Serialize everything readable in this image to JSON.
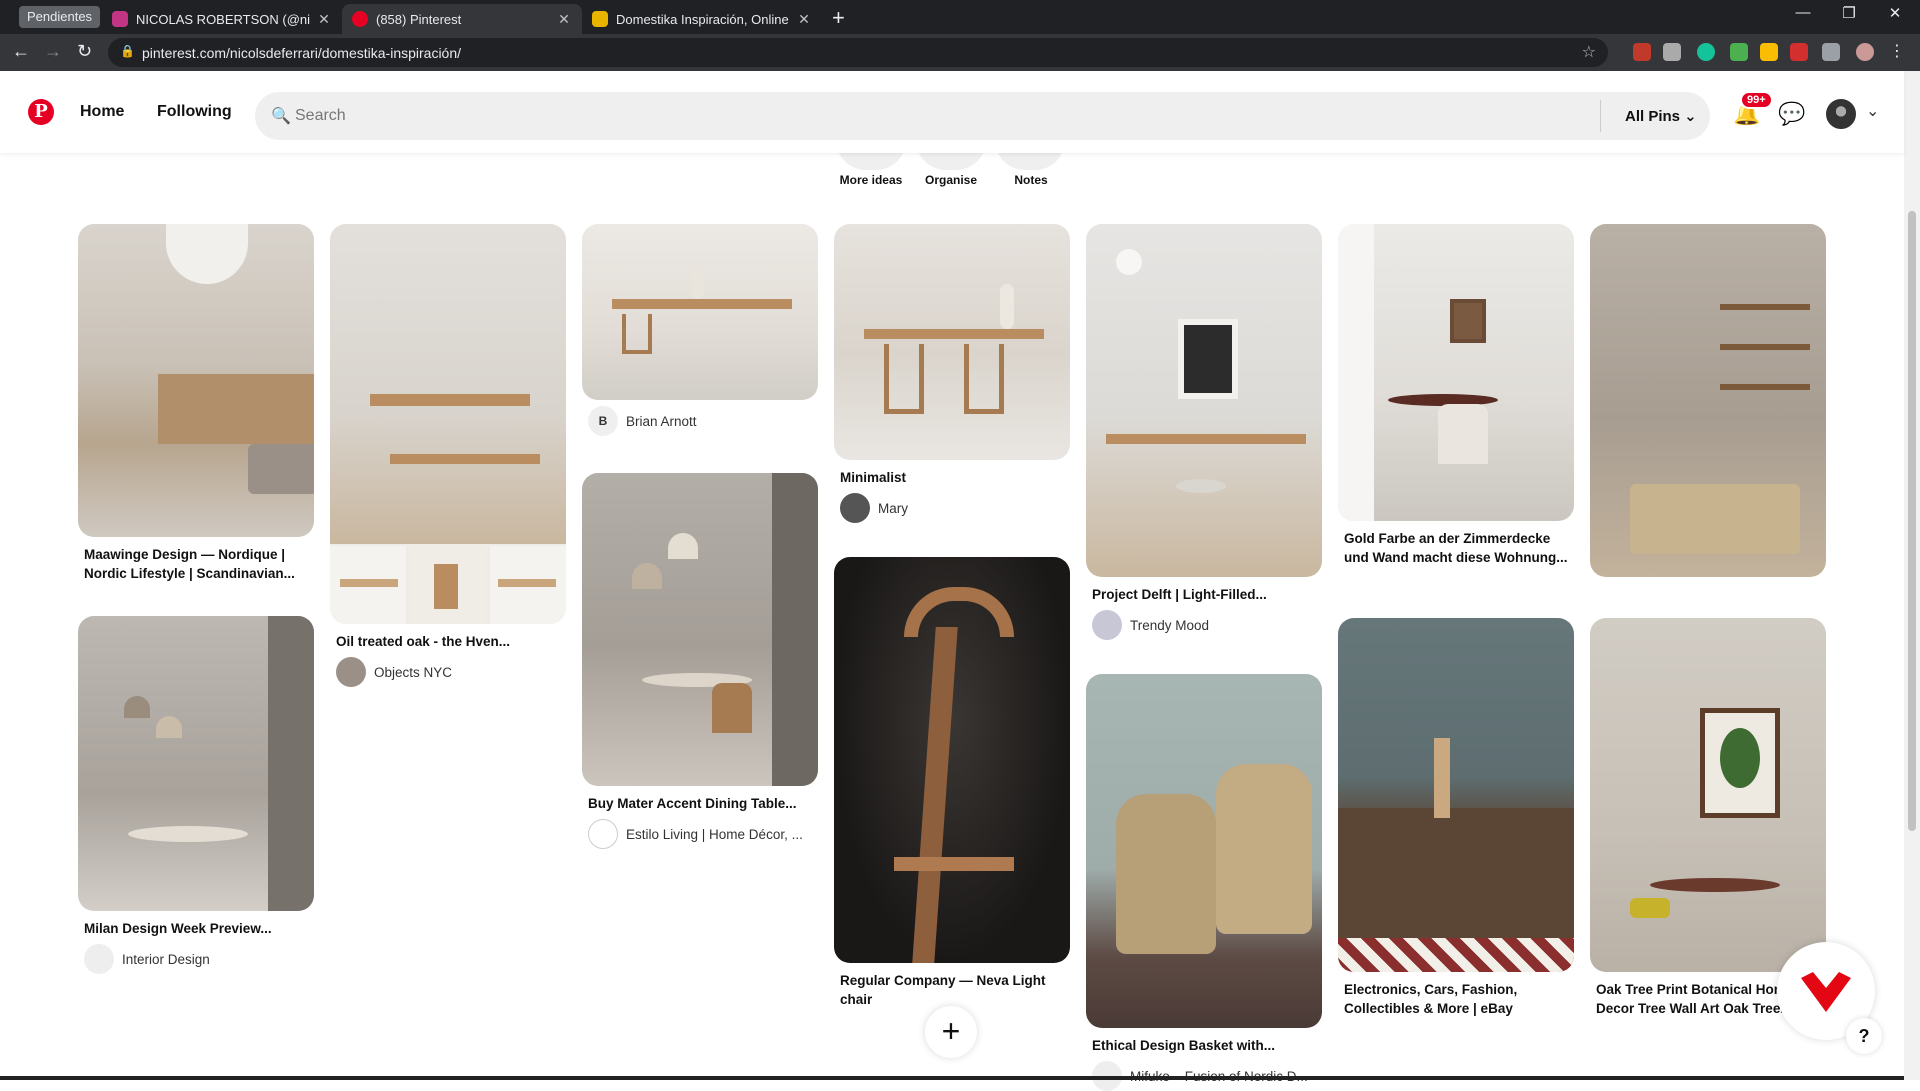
{
  "browser": {
    "profile_chip": "Pendientes",
    "tabs": [
      {
        "title": "NICOLAS ROBERTSON (@nicord",
        "color": "#c13584"
      },
      {
        "title": "(858) Pinterest",
        "color": "#e60023"
      },
      {
        "title": "Domestika Inspiración, Online W",
        "color": "#e8b400"
      }
    ],
    "url": "pinterest.com/nicolsdeferrari/domestika-inspiración/"
  },
  "header": {
    "home": "Home",
    "following": "Following",
    "search_placeholder": "Search",
    "filter": "All Pins",
    "notifications_badge": "99+"
  },
  "board_actions": [
    "More ideas",
    "Organise",
    "Notes"
  ],
  "pins": [
    {
      "title": "Maawinge Design — Nordique | Nordic Lifestyle | Scandinavian...",
      "owner": ""
    },
    {
      "title": "Milan Design Week Preview...",
      "owner": "Interior Design"
    },
    {
      "title": "Oil treated oak - the Hven...",
      "owner": "Objects NYC"
    },
    {
      "title": "",
      "owner": "Brian Arnott",
      "owner_initial": "B"
    },
    {
      "title": "Buy Mater Accent Dining Table...",
      "owner": "Estilo Living | Home Décor, ..."
    },
    {
      "title": "Minimalist",
      "owner": "Mary"
    },
    {
      "title": "Regular Company — Neva Light chair",
      "owner": ""
    },
    {
      "title": "Project Delft | Light-Filled...",
      "owner": "Trendy Mood"
    },
    {
      "title": "Ethical Design Basket with...",
      "owner": "Mifuko – Fusion of Nordic D..."
    },
    {
      "title": "Gold Farbe an der Zimmerdecke und Wand macht diese Wohnung...",
      "owner": ""
    },
    {
      "title": "Electronics, Cars, Fashion, Collectibles & More | eBay",
      "owner": ""
    },
    {
      "title": "",
      "owner": ""
    },
    {
      "title": "Oak Tree Print Botanical Home Decor Tree Wall Art Oak Tree...",
      "owner": ""
    }
  ]
}
